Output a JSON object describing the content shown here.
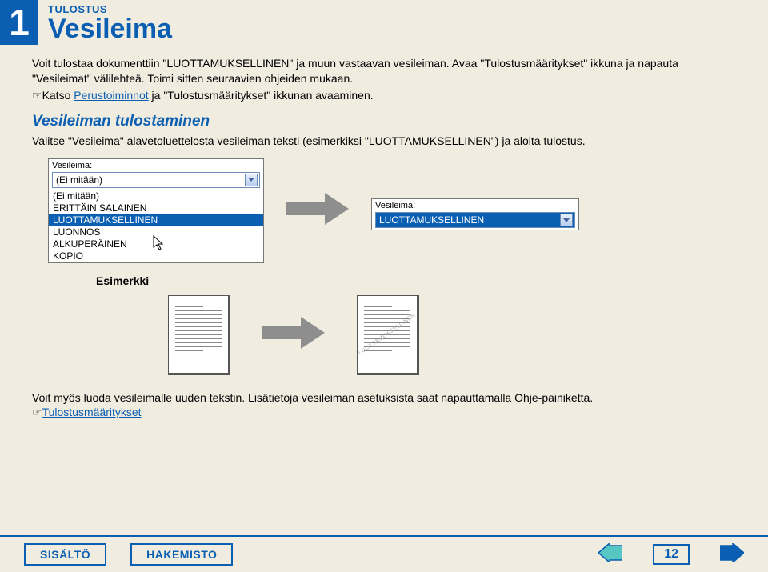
{
  "header": {
    "chapter": "1",
    "kicker": "TULOSTUS",
    "title": "Vesileima"
  },
  "intro": {
    "p1": "Voit tulostaa dokumenttiin \"LUOTTAMUKSELLINEN\" ja muun vastaavan vesileiman. Avaa \"Tulostusmääritykset\" ikkuna ja napauta \"Vesileimat\" välilehteä. Toimi sitten seuraavien ohjeiden mukaan.",
    "hand": "☞",
    "p2a": "Katso ",
    "link1": "Perustoiminnot",
    "p2b": " ja \"Tulostusmääritykset\" ikkunan avaaminen."
  },
  "section": {
    "heading": "Vesileiman tulostaminen",
    "body": "Valitse \"Vesileima\" alavetoluettelosta vesileiman teksti (esimerkiksi \"LUOTTAMUKSELLINEN\") ja aloita tulostus."
  },
  "dropdown": {
    "label": "Vesileima:",
    "selected": "(Ei mitään)",
    "items": [
      "(Ei mitään)",
      "ERITTÄIN SALAINEN",
      "LUOTTAMUKSELLINEN",
      "LUONNOS",
      "ALKUPERÄINEN",
      "KOPIO"
    ]
  },
  "dropdown2": {
    "label": "Vesileima:",
    "value": "LUOTTAMUKSELLINEN"
  },
  "example": {
    "label": "Esimerkki",
    "watermark": "LUOTTAMUKSELLINEN"
  },
  "notes": {
    "p": "Voit myös luoda vesileimalle uuden tekstin. Lisätietoja vesileiman asetuksista saat napauttamalla Ohje-painiketta.",
    "hand": "☞",
    "link": "Tulostusmääritykset"
  },
  "footer": {
    "b1": "SISÄLTÖ",
    "b2": "HAKEMISTO",
    "page": "12"
  }
}
